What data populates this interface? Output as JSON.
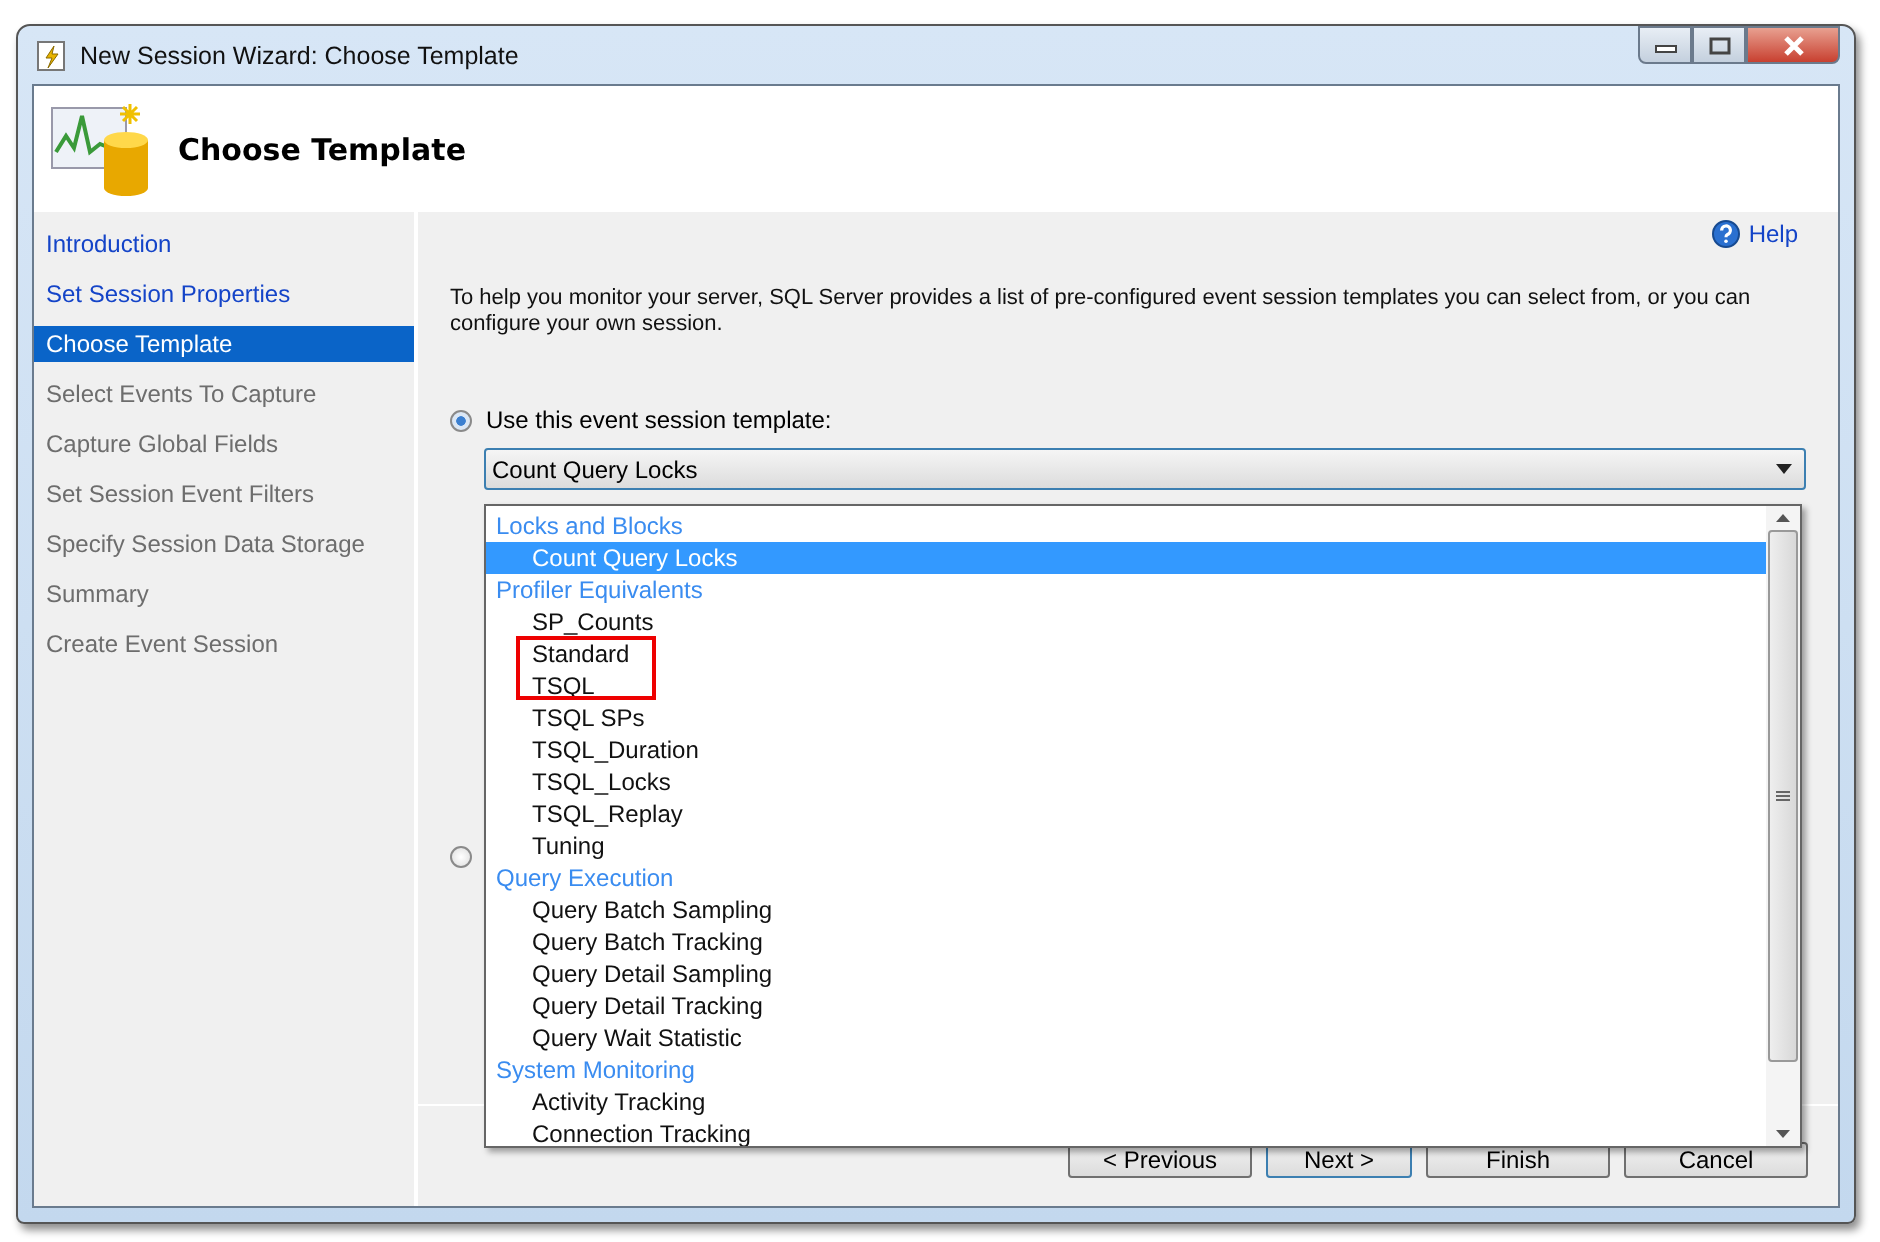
{
  "window": {
    "title": "New Session Wizard: Choose Template"
  },
  "header": {
    "title": "Choose Template"
  },
  "sidebar": {
    "items": [
      {
        "label": "Introduction",
        "selected": false,
        "disabled": false
      },
      {
        "label": "Set Session Properties",
        "selected": false,
        "disabled": false
      },
      {
        "label": "Choose Template",
        "selected": true,
        "disabled": false
      },
      {
        "label": "Select Events To Capture",
        "selected": false,
        "disabled": true
      },
      {
        "label": "Capture Global Fields",
        "selected": false,
        "disabled": true
      },
      {
        "label": "Set Session Event Filters",
        "selected": false,
        "disabled": true
      },
      {
        "label": "Specify Session Data Storage",
        "selected": false,
        "disabled": true
      },
      {
        "label": "Summary",
        "selected": false,
        "disabled": true
      },
      {
        "label": "Create Event Session",
        "selected": false,
        "disabled": true
      }
    ]
  },
  "help": {
    "label": "Help"
  },
  "description": "To help you monitor your server, SQL Server provides a list of pre-configured event session templates you can select from, or you can configure your own session.",
  "options": [
    {
      "label": "Use this event session template:",
      "selected": true
    },
    {
      "selected": false
    }
  ],
  "template_combo": {
    "value": "Count Query Locks",
    "expanded": true
  },
  "template_list": {
    "groups": [
      {
        "label": "Locks and Blocks",
        "children": [
          {
            "label": "Count Query Locks",
            "selected": true
          }
        ]
      },
      {
        "label": "Profiler Equivalents",
        "children": [
          {
            "label": "SP_Counts",
            "selected": false
          },
          {
            "label": "Standard",
            "selected": false
          },
          {
            "label": "TSQL",
            "selected": false
          },
          {
            "label": "TSQL SPs",
            "selected": false
          },
          {
            "label": "TSQL_Duration",
            "selected": false
          },
          {
            "label": "TSQL_Locks",
            "selected": false
          },
          {
            "label": "TSQL_Replay",
            "selected": false
          },
          {
            "label": "Tuning",
            "selected": false
          }
        ]
      },
      {
        "label": "Query Execution",
        "children": [
          {
            "label": "Query Batch Sampling",
            "selected": false
          },
          {
            "label": "Query Batch Tracking",
            "selected": false
          },
          {
            "label": "Query Detail Sampling",
            "selected": false
          },
          {
            "label": "Query Detail Tracking",
            "selected": false
          },
          {
            "label": "Query Wait Statistic",
            "selected": false
          }
        ]
      },
      {
        "label": "System Monitoring",
        "children": [
          {
            "label": "Activity Tracking",
            "selected": false
          },
          {
            "label": "Connection Tracking",
            "selected": false
          }
        ]
      }
    ]
  },
  "buttons": [
    {
      "label": "< Previous",
      "kind": "normal"
    },
    {
      "label": "Next >",
      "kind": "default"
    },
    {
      "label": "Finish",
      "kind": "normal"
    },
    {
      "label": "Cancel",
      "kind": "normal"
    }
  ]
}
